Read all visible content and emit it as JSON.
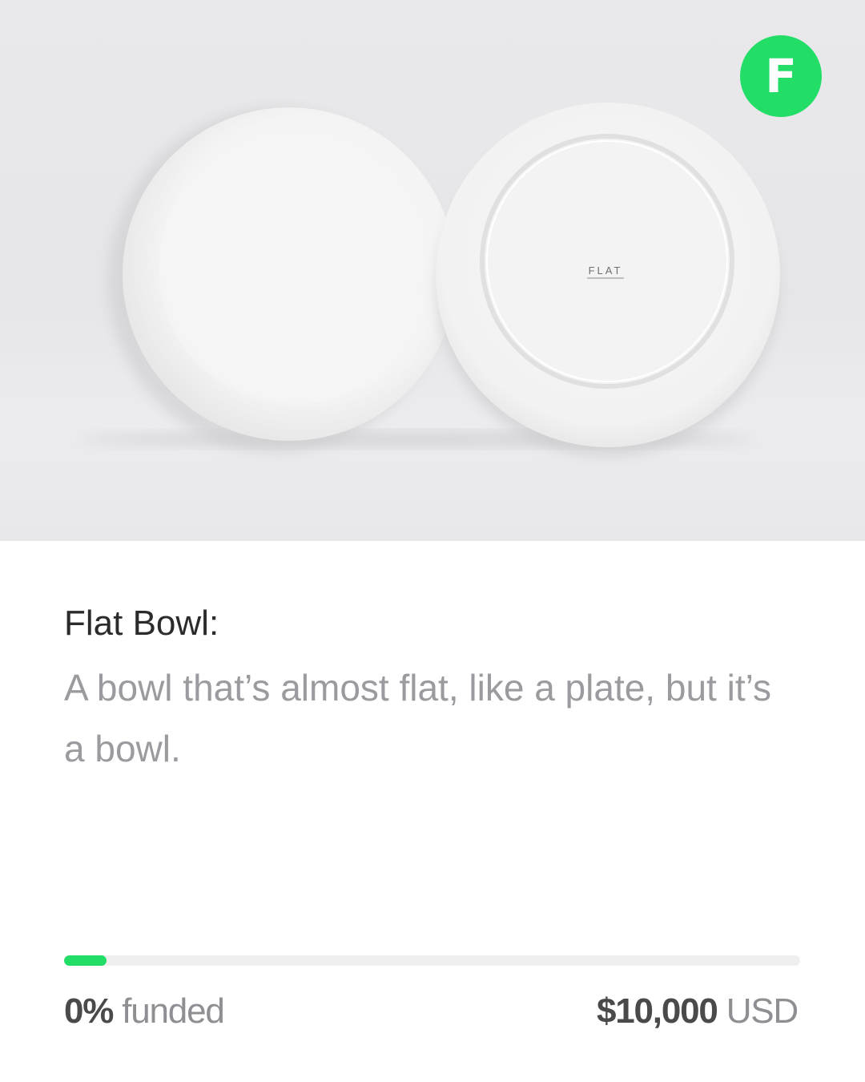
{
  "brand": {
    "icon": "letter-f-icon",
    "letter": "F",
    "color": "#22dd66"
  },
  "hero": {
    "plate_stamp": "FLAT"
  },
  "project": {
    "title": "Flat Bowl:",
    "description": "A bowl that’s almost flat, like a plate, but it’s a bowl."
  },
  "funding": {
    "percent_value": "0%",
    "percent_label": "funded",
    "progress_fraction": 0.0,
    "goal_amount": "$10,000",
    "goal_currency": "USD",
    "bar_color": "#22dd66"
  }
}
